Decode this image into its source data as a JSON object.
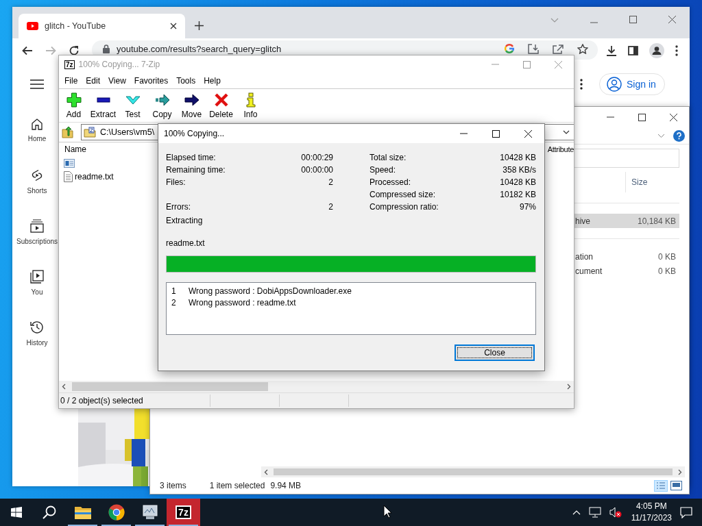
{
  "browser": {
    "tab": {
      "title": "glitch - YouTube"
    },
    "nav": [
      {
        "kind": "back",
        "disabled": false
      },
      {
        "kind": "forward",
        "disabled": true
      },
      {
        "kind": "reload",
        "disabled": false
      }
    ],
    "url": "youtube.com/results?search_query=glitch",
    "sidebar": [
      {
        "kind": "home",
        "label": "Home"
      },
      {
        "kind": "shorts",
        "label": "Shorts"
      },
      {
        "kind": "subscriptions",
        "label": "Subscriptions"
      },
      {
        "kind": "you",
        "label": "You"
      },
      {
        "kind": "history",
        "label": "History"
      }
    ],
    "sign_in": "Sign in"
  },
  "explorer": {
    "size_column": "Size",
    "groups": [
      {
        "rows": [
          {
            "name": "hive",
            "size": "10,184 KB",
            "selected": true
          }
        ]
      },
      {
        "rows": [
          {
            "name": "ation",
            "size": "0 KB",
            "selected": false
          },
          {
            "name": "cument",
            "size": "0 KB",
            "selected": false
          }
        ]
      }
    ],
    "status": {
      "count": "3 items",
      "selection": "1 item selected",
      "size": "9.94 MB"
    }
  },
  "archive_window": {
    "icon_text": "7z",
    "title": "100% Copying... 7-Zip",
    "menu": [
      "File",
      "Edit",
      "View",
      "Favorites",
      "Tools",
      "Help"
    ],
    "toolbar": [
      {
        "kind": "add",
        "label": "Add"
      },
      {
        "kind": "extract",
        "label": "Extract"
      },
      {
        "kind": "test",
        "label": "Test"
      },
      {
        "kind": "copy",
        "label": "Copy"
      },
      {
        "kind": "move",
        "label": "Move"
      },
      {
        "kind": "delete",
        "label": "Delete"
      },
      {
        "kind": "info",
        "label": "Info"
      }
    ],
    "path": "C:\\Users\\vm5\\",
    "columns": {
      "name": "Name",
      "attribute": "Attribute"
    },
    "files": [
      {
        "kind": "app"
      },
      {
        "kind": "text",
        "name": "readme.txt"
      }
    ],
    "status": "0 / 2 object(s) selected"
  },
  "dialog": {
    "title": "100% Copying...",
    "stats": [
      {
        "left": {
          "label": "Elapsed time:",
          "value": "00:00:29"
        },
        "right": {
          "label": "Total size:",
          "value": "10428 KB"
        }
      },
      {
        "left": {
          "label": "Remaining time:",
          "value": "00:00:00"
        },
        "right": {
          "label": "Speed:",
          "value": "358 KB/s"
        }
      },
      {
        "left": {
          "label": "Files:",
          "value": "2"
        },
        "right": {
          "label": "Processed:",
          "value": "10428 KB"
        }
      },
      {
        "right": {
          "label": "Compressed size:",
          "value": "10182 KB"
        }
      },
      {
        "left": {
          "label": "Errors:",
          "value": "2"
        },
        "right": {
          "label": "Compression ratio:",
          "value": "97%"
        }
      }
    ],
    "operation": "Extracting",
    "current_file": "readme.txt",
    "progress": {
      "level": 1
    },
    "log": [
      {
        "number": "1",
        "message": "Wrong password : DobiAppsDownloader.exe"
      },
      {
        "number": "2",
        "message": "Wrong password : readme.txt"
      }
    ],
    "close": "Close"
  },
  "taskbar": {
    "apps": [
      {
        "kind": "explorer",
        "running": true,
        "selected": false
      },
      {
        "kind": "browser",
        "running": true,
        "selected": false
      },
      {
        "kind": "monitor",
        "running": true,
        "selected": false
      },
      {
        "kind": "archiver",
        "glyph": "7z",
        "running": true,
        "selected": true
      }
    ],
    "time": "4:05 PM",
    "date": "11/17/2023"
  }
}
